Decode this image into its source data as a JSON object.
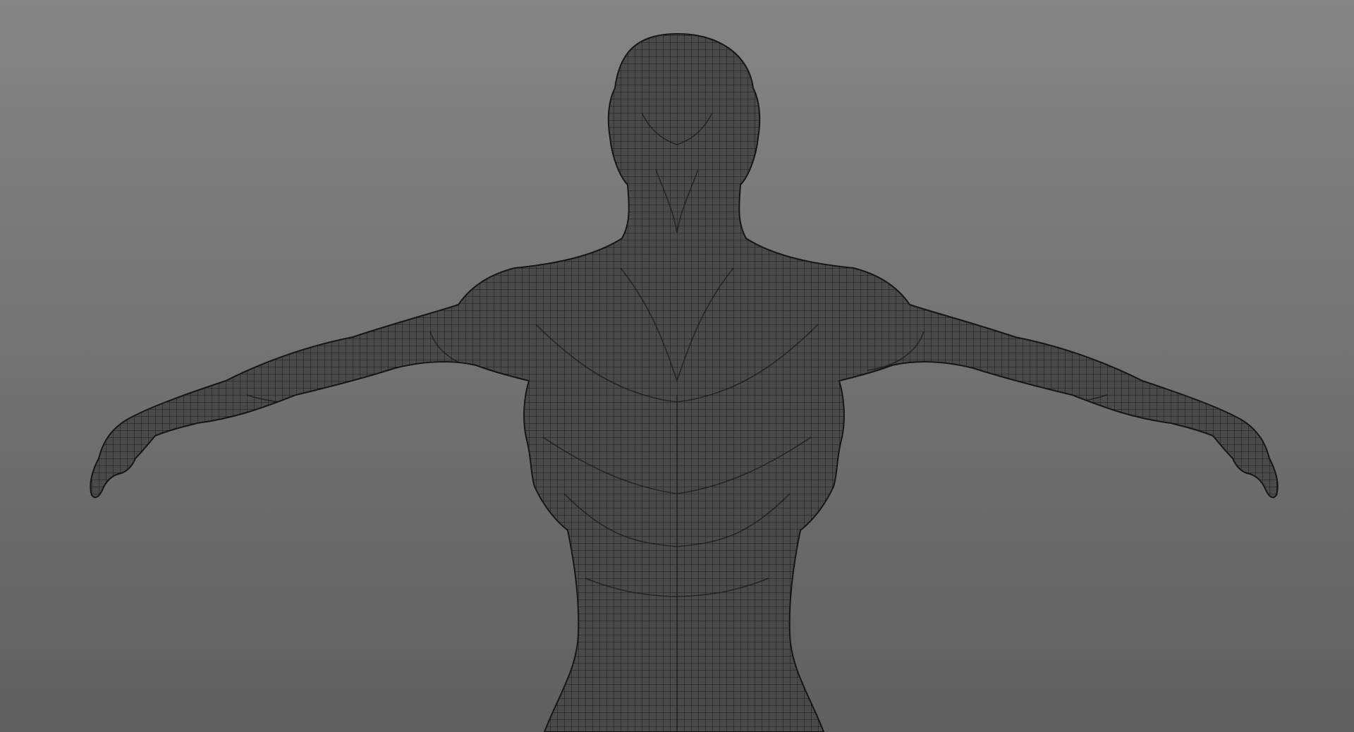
{
  "viewport": {
    "background_top_color": "#858585",
    "background_bottom_color": "#5f5f5f",
    "mesh_fill_color": "#4a4a4a",
    "wire_color": "#191919",
    "outline_color": "#151515"
  },
  "model": {
    "display_mode": "wireframe-on-shaded",
    "pose": "t-pose",
    "view": "front"
  }
}
